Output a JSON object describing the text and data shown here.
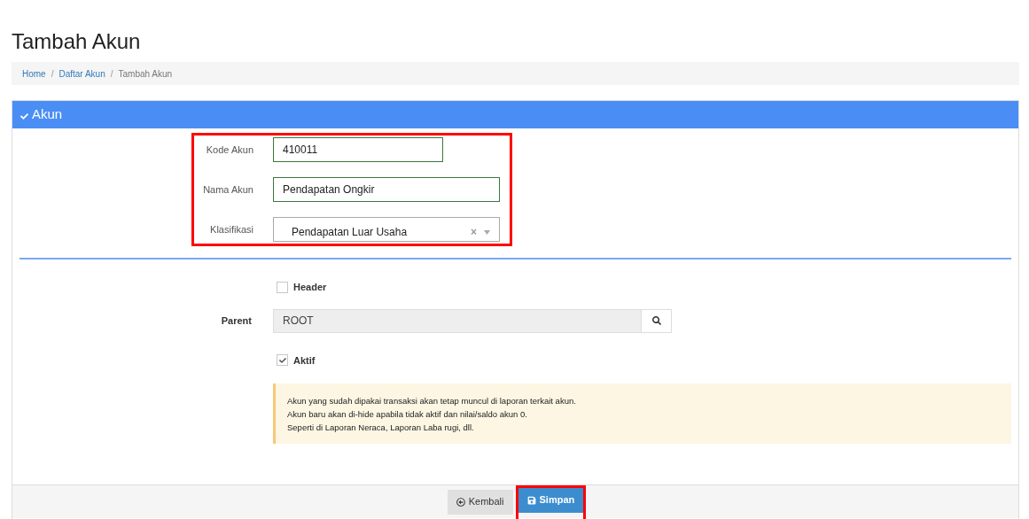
{
  "page_title": "Tambah Akun",
  "breadcrumb": [
    {
      "label": "Home",
      "current": false
    },
    {
      "separator": "/",
      "label": "Daftar Akun",
      "current": false
    },
    {
      "separator": "/",
      "label": "Tambah Akun",
      "current": true
    }
  ],
  "panel": {
    "title": "Akun",
    "main_fields": {
      "highlighted": true,
      "fields": [
        {
          "kind": "short_text",
          "label": "Kode Akun",
          "value": "410011"
        },
        {
          "kind": "text",
          "label": "Nama Akun",
          "value": "Pendapatan Ongkir"
        },
        {
          "kind": "select",
          "label": "Klasifikasi",
          "value": "Pendapatan Luar Usaha",
          "clear": "×"
        }
      ]
    },
    "header_checkbox": {
      "label": "Header",
      "checked": false
    },
    "parent": {
      "label": "Parent",
      "value": "ROOT"
    },
    "aktif_checkbox": {
      "label": "Aktif",
      "checked": true
    },
    "notice": [
      "Akun yang sudah dipakai transaksi akan tetap muncul di laporan terkait akun.",
      "Akun baru akan di-hide apabila tidak aktif dan nilai/saldo akun 0.",
      "Seperti di Laporan Neraca, Laporan Laba rugi, dll."
    ],
    "buttons": [
      {
        "kind": "back",
        "label": "Kembali",
        "highlighted": false
      },
      {
        "kind": "save",
        "label": "Simpan",
        "highlighted": true
      }
    ]
  }
}
